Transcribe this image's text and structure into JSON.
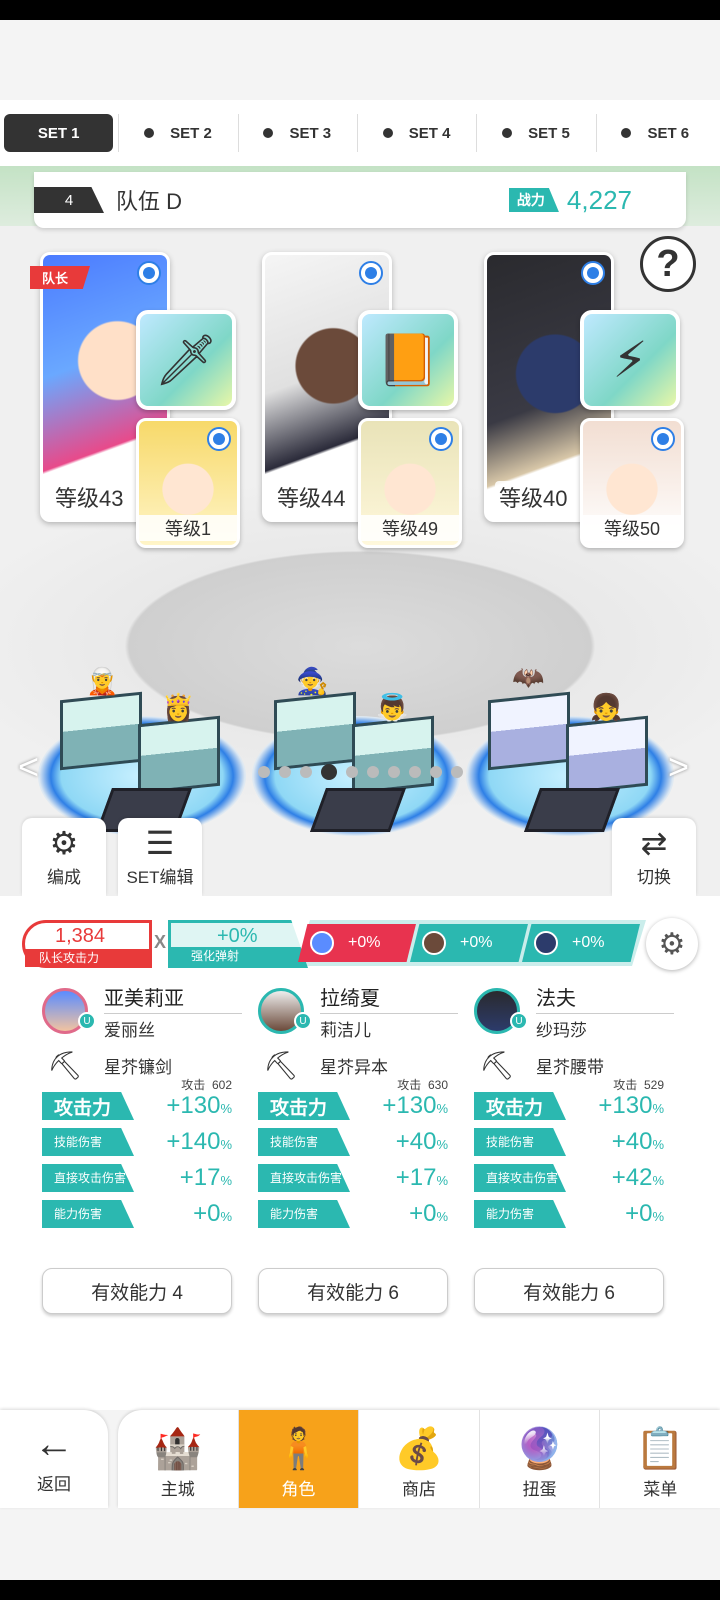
{
  "tabs": [
    {
      "label": "SET 1",
      "active": true
    },
    {
      "label": "SET 2",
      "active": false
    },
    {
      "label": "SET 3",
      "active": false
    },
    {
      "label": "SET 4",
      "active": false
    },
    {
      "label": "SET 5",
      "active": false
    },
    {
      "label": "SET 6",
      "active": false
    }
  ],
  "team": {
    "number": "4",
    "name": "队伍 D",
    "power_label": "战力",
    "power_value": "4,227"
  },
  "leader_tag": "队长",
  "characters": [
    {
      "level": "等级43",
      "sub_level": "等级1",
      "equip_icon": "sword-icon"
    },
    {
      "level": "等级44",
      "sub_level": "等级49",
      "equip_icon": "book-icon"
    },
    {
      "level": "等级40",
      "sub_level": "等级50",
      "equip_icon": "belt-icon"
    }
  ],
  "pager": {
    "count": 10,
    "active_index": 3
  },
  "tools": {
    "formation": "编成",
    "set_edit": "SET编辑",
    "switch": "切换"
  },
  "bonus": {
    "leader_atk_value": "1,384",
    "leader_atk_label": "队长攻击力",
    "multiplier": "X",
    "boost_value": "+0%",
    "boost_label": "强化弹射",
    "chips": [
      "+0%",
      "+0%",
      "+0%"
    ]
  },
  "members": [
    {
      "name": "亚美莉亚",
      "sub": "爱丽丝",
      "equip": "星芥镰剑",
      "base_label": "攻击",
      "base_value": "602",
      "stats": {
        "atk": "+130",
        "skill": "+140",
        "direct": "+17",
        "ability": "+0"
      },
      "effective": "有效能力 4"
    },
    {
      "name": "拉绮夏",
      "sub": "莉洁儿",
      "equip": "星芥异本",
      "base_label": "攻击",
      "base_value": "630",
      "stats": {
        "atk": "+130",
        "skill": "+40",
        "direct": "+17",
        "ability": "+0"
      },
      "effective": "有效能力 6"
    },
    {
      "name": "法夫",
      "sub": "纱玛莎",
      "equip": "星芥腰带",
      "base_label": "攻击",
      "base_value": "529",
      "stats": {
        "atk": "+130",
        "skill": "+40",
        "direct": "+42",
        "ability": "+0"
      },
      "effective": "有效能力 6"
    }
  ],
  "stat_labels": {
    "atk": "攻击力",
    "skill": "技能伤害",
    "direct": "直接攻击伤害",
    "ability": "能力伤害",
    "unit": "%"
  },
  "nav": {
    "back": "返回",
    "items": [
      "主城",
      "角色",
      "商店",
      "扭蛋",
      "菜单"
    ],
    "active_index": 1
  },
  "colors": {
    "accent": "#2bb8b0",
    "leader": "#e83a3a",
    "nav_active": "#f7a21a",
    "select": "#2e7fe6"
  }
}
